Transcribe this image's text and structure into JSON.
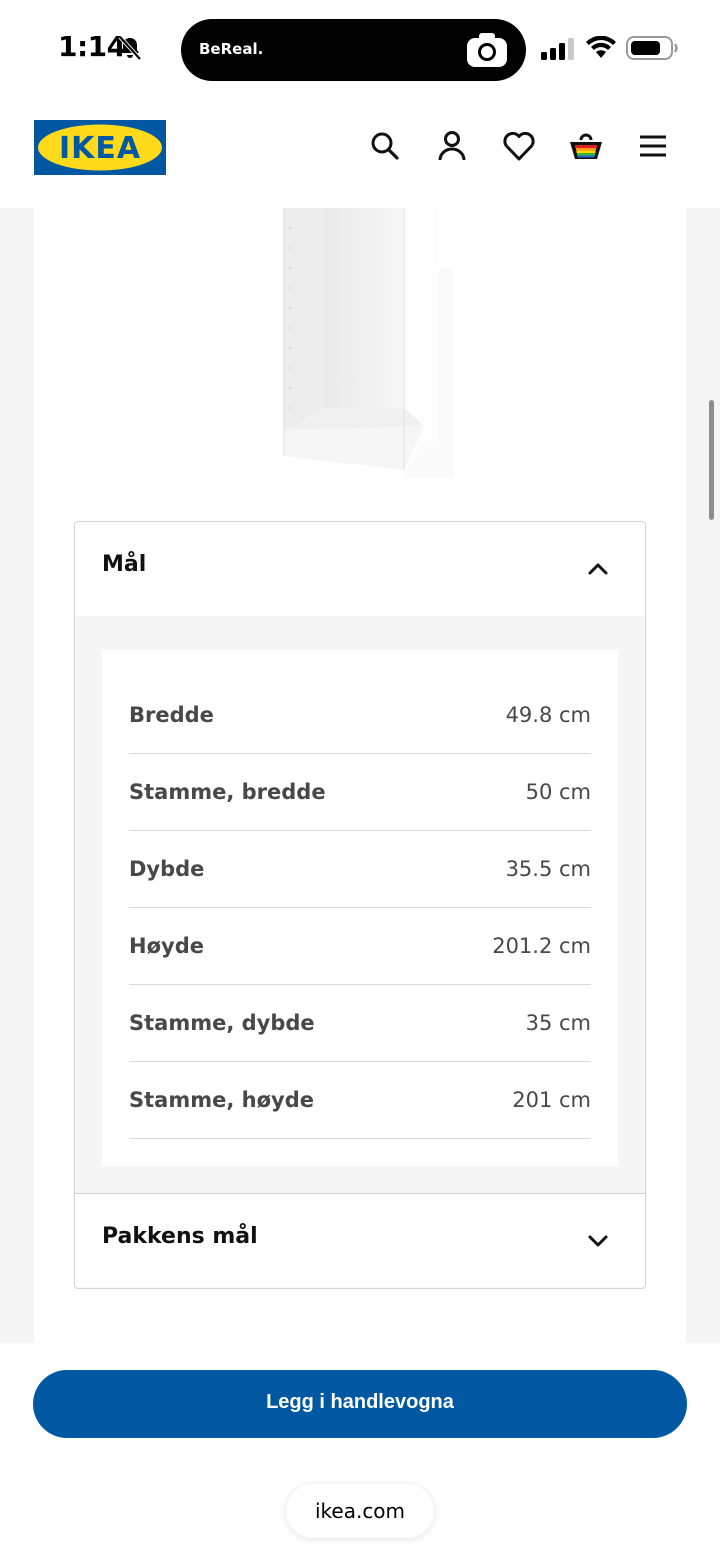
{
  "status_bar": {
    "time": "1:14",
    "island_app": "BeReal."
  },
  "header": {
    "logo_text": "IKEA",
    "icons": [
      "search-icon",
      "account-icon",
      "heart-icon",
      "cart-icon",
      "menu-icon"
    ],
    "brand_colors": {
      "blue": "#0058a3",
      "yellow": "#ffda1a"
    }
  },
  "accordion": {
    "dimensions_title": "Mål",
    "dimensions": [
      {
        "label": "Bredde",
        "value": "49.8 cm"
      },
      {
        "label": "Stamme, bredde",
        "value": "50 cm"
      },
      {
        "label": "Dybde",
        "value": "35.5 cm"
      },
      {
        "label": "Høyde",
        "value": "201.2 cm"
      },
      {
        "label": "Stamme, dybde",
        "value": "35 cm"
      },
      {
        "label": "Stamme, høyde",
        "value": "201 cm"
      }
    ],
    "package_title": "Pakkens mål"
  },
  "cart_button_label": "Legg i handlevogna",
  "url": "ikea.com"
}
